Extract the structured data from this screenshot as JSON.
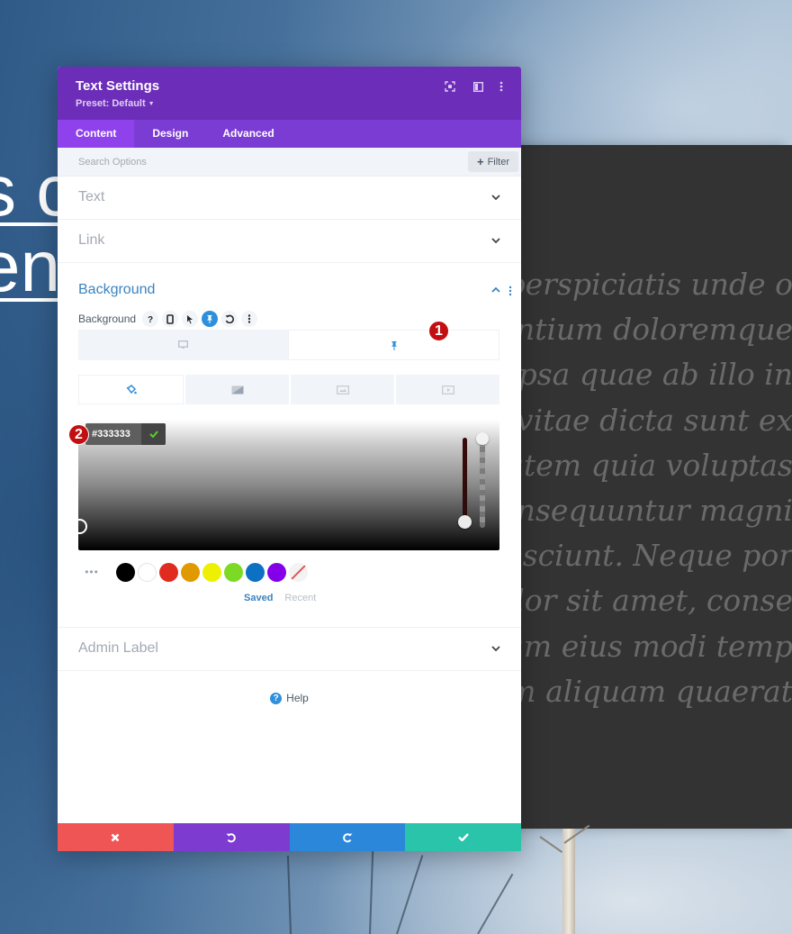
{
  "background_page": {
    "hero_lines": [
      "s c",
      "en"
    ],
    "lorem_lines": [
      "ut perspiciatis unde o",
      "santium doloremque",
      "e ipsa quae ab illo in",
      "ae vitae dicta sunt ex",
      "ptatem quia voluptas",
      "consequuntur magni",
      "i nesciunt. Neque por",
      "dolor sit amet, conse",
      "quam eius modi temp",
      "nam aliquam quaerat"
    ]
  },
  "panel": {
    "title": "Text Settings",
    "preset": "Preset: Default",
    "header_icons": [
      "fullscreen-icon",
      "split-view-icon",
      "more-options-icon"
    ],
    "tabs": [
      {
        "label": "Content",
        "active": true
      },
      {
        "label": "Design",
        "active": false
      },
      {
        "label": "Advanced",
        "active": false
      }
    ],
    "search": {
      "placeholder": "Search Options",
      "value": ""
    },
    "filter_label": "Filter",
    "sections": {
      "text": "Text",
      "link": "Link",
      "background": "Background",
      "admin_label": "Admin Label"
    },
    "background_field": {
      "label": "Background",
      "icons": [
        "help-icon",
        "responsive-icon",
        "hover-icon",
        "sticky-icon",
        "reset-icon",
        "more-icon"
      ],
      "active_icon": "sticky-icon",
      "state_tabs": [
        {
          "name": "desktop",
          "icon": "desktop-icon",
          "active": false
        },
        {
          "name": "sticky",
          "icon": "pin-icon",
          "active": true
        }
      ],
      "type_tabs": [
        {
          "name": "color",
          "icon": "paint-bucket-icon",
          "active": true
        },
        {
          "name": "gradient",
          "icon": "gradient-icon",
          "active": false
        },
        {
          "name": "image",
          "icon": "image-icon",
          "active": false
        },
        {
          "name": "video",
          "icon": "video-icon",
          "active": false
        }
      ],
      "hex_value": "#333333",
      "alpha": 1.0,
      "swatches": [
        {
          "name": "black",
          "color": "#000000"
        },
        {
          "name": "white",
          "color": "#ffffff"
        },
        {
          "name": "red",
          "color": "#e02b20"
        },
        {
          "name": "orange",
          "color": "#e09900"
        },
        {
          "name": "yellow",
          "color": "#edf000"
        },
        {
          "name": "green",
          "color": "#7cda24"
        },
        {
          "name": "blue",
          "color": "#0c71c3"
        },
        {
          "name": "purple",
          "color": "#8300e9"
        },
        {
          "name": "none",
          "color": "transparent"
        }
      ],
      "palette_tabs": [
        {
          "label": "Saved",
          "active": true
        },
        {
          "label": "Recent",
          "active": false
        }
      ]
    },
    "help_label": "Help",
    "footer": [
      {
        "name": "discard",
        "icon": "close-icon",
        "color": "#ef5555"
      },
      {
        "name": "undo",
        "icon": "undo-icon",
        "color": "#7e3bd0"
      },
      {
        "name": "redo",
        "icon": "redo-icon",
        "color": "#2b87da"
      },
      {
        "name": "save",
        "icon": "check-icon",
        "color": "#29c4a9"
      }
    ]
  },
  "annotations": [
    "1",
    "2"
  ],
  "colors": {
    "header_purple": "#6c2eb9",
    "tab_purple": "#7b3cd3",
    "active_tab_purple": "#8f42ec",
    "accent_blue": "#2e8fdb",
    "section_active_blue": "#3b83c0",
    "badge_red": "#c20f12",
    "dark_block": "#333333"
  }
}
